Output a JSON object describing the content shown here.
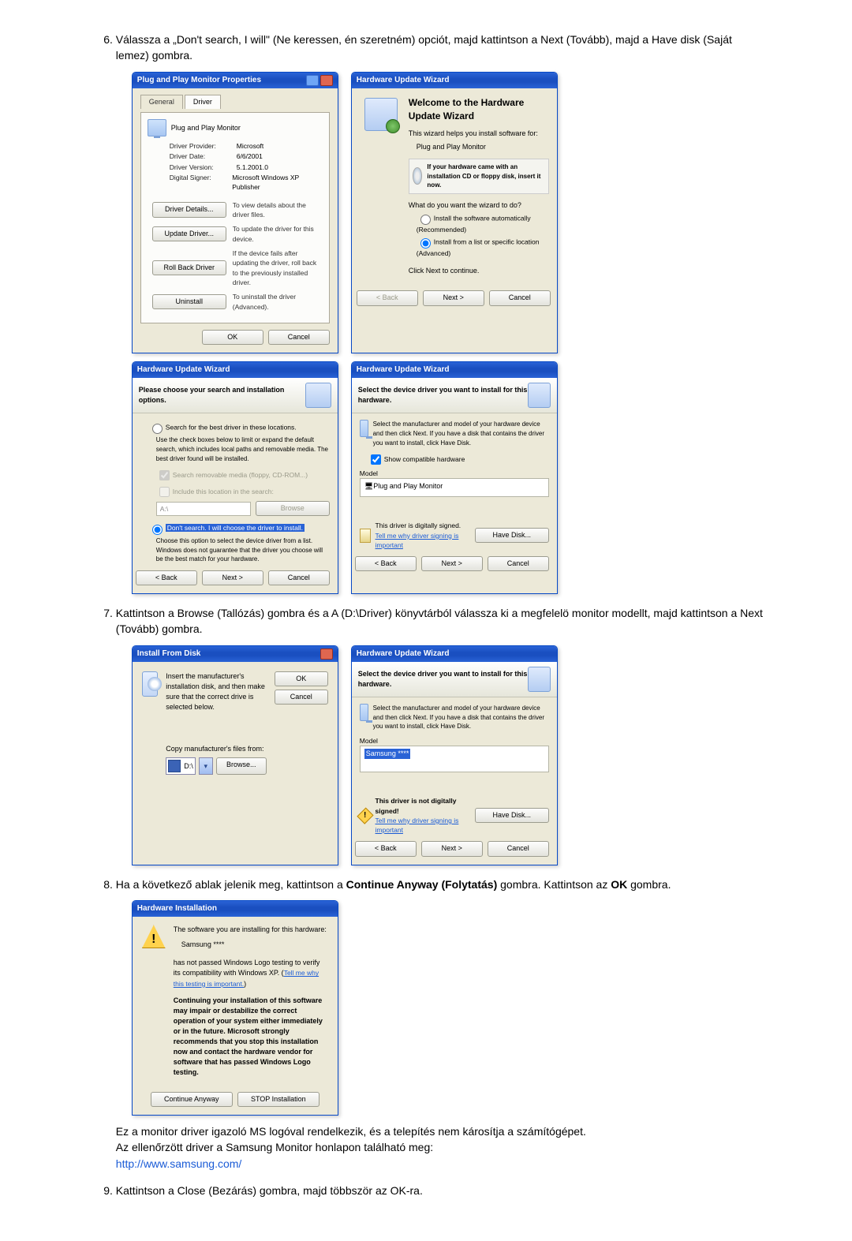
{
  "steps": {
    "s6": "Válassza a „Don't search, I will\" (Ne keressen, én szeretném) opciót, majd kattintson a Next (Tovább), majd a Have disk (Saját lemez) gombra.",
    "s7": "Kattintson a Browse (Tallózás) gombra és a A (D:\\Driver) könyvtárból válassza ki a megfelelö monitor modellt, majd kattintson a Next (Tovább) gombra.",
    "s8_a": "Ha a következő ablak jelenik meg, kattintson a ",
    "s8_b": "Continue Anyway (Folytatás)",
    "s8_c": " gombra. Kattintson az ",
    "s8_d": "OK",
    "s8_e": " gombra.",
    "s8_post1": "Ez a monitor driver igazoló MS logóval rendelkezik, és a telepítés nem károsítja a számítógépet.",
    "s8_post2": "Az ellenőrzött driver a Samsung Monitor honlapon található meg:",
    "s8_url": "http://www.samsung.com/",
    "s9": "Kattintson a Close (Bezárás) gombra, majd többször az OK-ra."
  },
  "props": {
    "title": "Plug and Play Monitor Properties",
    "tab_general": "General",
    "tab_driver": "Driver",
    "header": "Plug and Play Monitor",
    "provider_l": "Driver Provider:",
    "provider_v": "Microsoft",
    "date_l": "Driver Date:",
    "date_v": "6/6/2001",
    "ver_l": "Driver Version:",
    "ver_v": "5.1.2001.0",
    "sign_l": "Digital Signer:",
    "sign_v": "Microsoft Windows XP Publisher",
    "btn_details": "Driver Details...",
    "btn_details_d": "To view details about the driver files.",
    "btn_update": "Update Driver...",
    "btn_update_d": "To update the driver for this device.",
    "btn_roll": "Roll Back Driver",
    "btn_roll_d": "If the device fails after updating the driver, roll back to the previously installed driver.",
    "btn_unin": "Uninstall",
    "btn_unin_d": "To uninstall the driver (Advanced).",
    "ok": "OK",
    "cancel": "Cancel"
  },
  "wiz1": {
    "title": "Hardware Update Wizard",
    "h": "Welcome to the Hardware Update Wizard",
    "p1": "This wizard helps you install software for:",
    "p2": "Plug and Play Monitor",
    "cd": "If your hardware came with an installation CD or floppy disk, insert it now.",
    "q": "What do you want the wizard to do?",
    "r1": "Install the software automatically (Recommended)",
    "r2": "Install from a list or specific location (Advanced)",
    "p3": "Click Next to continue.",
    "back": "< Back",
    "next": "Next >",
    "cancel": "Cancel"
  },
  "wiz2": {
    "title": "Hardware Update Wizard",
    "sub": "Please choose your search and installation options.",
    "r1": "Search for the best driver in these locations.",
    "r1d": "Use the check boxes below to limit or expand the default search, which includes local paths and removable media. The best driver found will be installed.",
    "c1": "Search removable media (floppy, CD-ROM...)",
    "c2": "Include this location in the search:",
    "path": "A:\\",
    "browse": "Browse",
    "r2": "Don't search. I will choose the driver to install.",
    "r2d": "Choose this option to select the device driver from a list. Windows does not guarantee that the driver you choose will be the best match for your hardware.",
    "back": "< Back",
    "next": "Next >",
    "cancel": "Cancel"
  },
  "wiz3": {
    "title": "Hardware Update Wizard",
    "sub": "Select the device driver you want to install for this hardware.",
    "hint": "Select the manufacturer and model of your hardware device and then click Next. If you have a disk that contains the driver you want to install, click Have Disk.",
    "chk": "Show compatible hardware",
    "model_l": "Model",
    "model_v": "Plug and Play Monitor",
    "signed": "This driver is digitally signed.",
    "why": "Tell me why driver signing is important",
    "havedisk": "Have Disk...",
    "back": "< Back",
    "next": "Next >",
    "cancel": "Cancel"
  },
  "install": {
    "title": "Install From Disk",
    "msg": "Insert the manufacturer's installation disk, and then make sure that the correct drive is selected below.",
    "ok": "OK",
    "cancel": "Cancel",
    "copy": "Copy manufacturer's files from:",
    "drive": "D:\\",
    "browse": "Browse..."
  },
  "wiz4": {
    "title": "Hardware Update Wizard",
    "sub": "Select the device driver you want to install for this hardware.",
    "hint": "Select the manufacturer and model of your hardware device and then click Next. If you have a disk that contains the driver you want to install, click Have Disk.",
    "model_l": "Model",
    "model_v": "Samsung ****",
    "unsigned": "This driver is not digitally signed!",
    "why": "Tell me why driver signing is important",
    "havedisk": "Have Disk...",
    "back": "< Back",
    "next": "Next >",
    "cancel": "Cancel"
  },
  "hwinst": {
    "title": "Hardware Installation",
    "l1": "The software you are installing for this hardware:",
    "l2": "Samsung ****",
    "l3a": "has not passed Windows Logo testing to verify its compatibility with Windows XP. (",
    "l3b": "Tell me why this testing is important.",
    "l3c": ")",
    "warn": "Continuing your installation of this software may impair or destabilize the correct operation of your system either immediately or in the future. Microsoft strongly recommends that you stop this installation now and contact the hardware vendor for software that has passed Windows Logo testing.",
    "cont": "Continue Anyway",
    "stop": "STOP Installation"
  }
}
